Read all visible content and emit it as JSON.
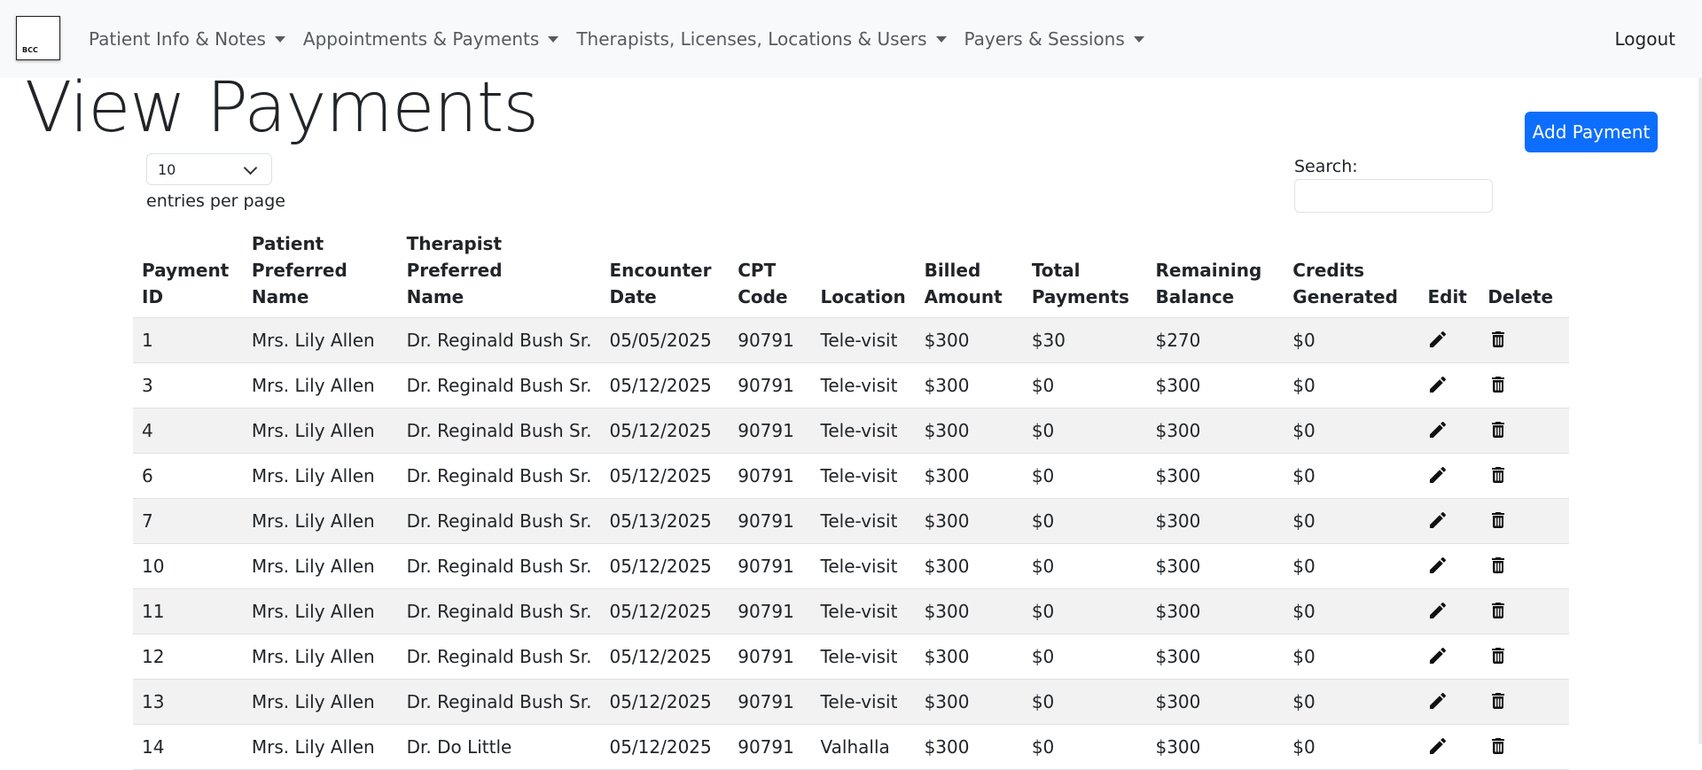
{
  "app": {
    "logo_text": "BCC"
  },
  "nav": {
    "items": [
      {
        "label": "Patient Info & Notes"
      },
      {
        "label": "Appointments & Payments"
      },
      {
        "label": "Therapists, Licenses, Locations & Users"
      },
      {
        "label": "Payers & Sessions"
      }
    ],
    "logout_label": "Logout"
  },
  "page": {
    "title": "View Payments",
    "add_button_label": "Add Payment"
  },
  "controls": {
    "entries_value": "10",
    "entries_label": "entries per page",
    "search_label": "Search:",
    "search_value": ""
  },
  "table": {
    "columns": [
      {
        "line1": "Payment",
        "line2": "ID"
      },
      {
        "line1": "Patient Preferred",
        "line2": "Name"
      },
      {
        "line1": "Therapist Preferred",
        "line2": "Name"
      },
      {
        "line1": "Encounter",
        "line2": "Date"
      },
      {
        "line1": "CPT",
        "line2": "Code"
      },
      {
        "line1": "",
        "line2": "Location"
      },
      {
        "line1": "Billed",
        "line2": "Amount"
      },
      {
        "line1": "Total",
        "line2": "Payments"
      },
      {
        "line1": "Remaining",
        "line2": "Balance"
      },
      {
        "line1": "Credits",
        "line2": "Generated"
      },
      {
        "line1": "",
        "line2": "Edit"
      },
      {
        "line1": "",
        "line2": "Delete"
      }
    ],
    "rows": [
      [
        "1",
        "Mrs. Lily Allen",
        "Dr. Reginald Bush Sr.",
        "05/05/2025",
        "90791",
        "Tele-visit",
        "$300",
        "$30",
        "$270",
        "$0"
      ],
      [
        "3",
        "Mrs. Lily Allen",
        "Dr. Reginald Bush Sr.",
        "05/12/2025",
        "90791",
        "Tele-visit",
        "$300",
        "$0",
        "$300",
        "$0"
      ],
      [
        "4",
        "Mrs. Lily Allen",
        "Dr. Reginald Bush Sr.",
        "05/12/2025",
        "90791",
        "Tele-visit",
        "$300",
        "$0",
        "$300",
        "$0"
      ],
      [
        "6",
        "Mrs. Lily Allen",
        "Dr. Reginald Bush Sr.",
        "05/12/2025",
        "90791",
        "Tele-visit",
        "$300",
        "$0",
        "$300",
        "$0"
      ],
      [
        "7",
        "Mrs. Lily Allen",
        "Dr. Reginald Bush Sr.",
        "05/13/2025",
        "90791",
        "Tele-visit",
        "$300",
        "$0",
        "$300",
        "$0"
      ],
      [
        "10",
        "Mrs. Lily Allen",
        "Dr. Reginald Bush Sr.",
        "05/12/2025",
        "90791",
        "Tele-visit",
        "$300",
        "$0",
        "$300",
        "$0"
      ],
      [
        "11",
        "Mrs. Lily Allen",
        "Dr. Reginald Bush Sr.",
        "05/12/2025",
        "90791",
        "Tele-visit",
        "$300",
        "$0",
        "$300",
        "$0"
      ],
      [
        "12",
        "Mrs. Lily Allen",
        "Dr. Reginald Bush Sr.",
        "05/12/2025",
        "90791",
        "Tele-visit",
        "$300",
        "$0",
        "$300",
        "$0"
      ],
      [
        "13",
        "Mrs. Lily Allen",
        "Dr. Reginald Bush Sr.",
        "05/12/2025",
        "90791",
        "Tele-visit",
        "$300",
        "$0",
        "$300",
        "$0"
      ],
      [
        "14",
        "Mrs. Lily Allen",
        "Dr. Do Little",
        "05/12/2025",
        "90791",
        "Valhalla",
        "$300",
        "$0",
        "$300",
        "$0"
      ]
    ],
    "row_icons": {
      "edit": "pencil-icon",
      "delete": "trash-icon"
    }
  },
  "colors": {
    "primary": "#0d6efd",
    "navbar_bg": "#f8f9fa",
    "stripe": "#f2f2f2"
  }
}
